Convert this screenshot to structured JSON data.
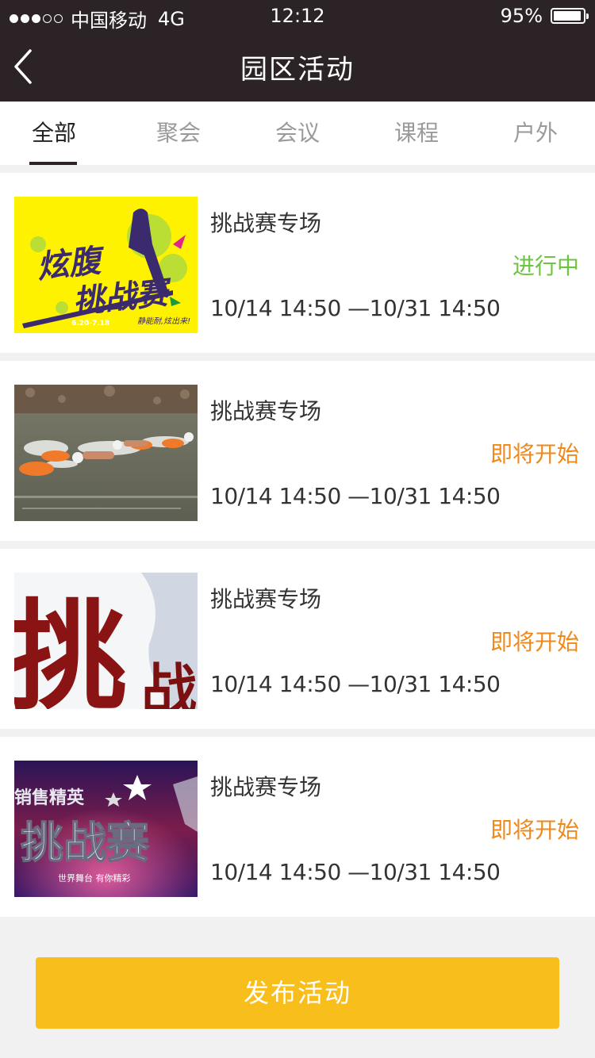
{
  "status_bar": {
    "carrier": "中国移动",
    "network": "4G",
    "time": "12:12",
    "battery": "95%",
    "signal_filled": 3,
    "signal_total": 5
  },
  "nav": {
    "title": "园区活动",
    "back_icon": "chevron-left-icon"
  },
  "tabs": [
    {
      "label": "全部",
      "active": true
    },
    {
      "label": "聚会",
      "active": false
    },
    {
      "label": "会议",
      "active": false
    },
    {
      "label": "课程",
      "active": false
    },
    {
      "label": "户外",
      "active": false
    }
  ],
  "activities": [
    {
      "title": "挑战赛专场",
      "status": "进行中",
      "status_color": "#6cc43f",
      "time_range": "10/14  14:50 —10/31  14:50",
      "thumb_text": "炫腹挑战赛",
      "thumb_sub": "6.20-7.18",
      "thumb_slogan": "静能耐,炫出来!"
    },
    {
      "title": "挑战赛专场",
      "status": "即将开始",
      "status_color": "#ee8a1c",
      "time_range": "10/14  14:50 —10/31  14:50"
    },
    {
      "title": "挑战赛专场",
      "status": "即将开始",
      "status_color": "#ee8a1c",
      "time_range": "10/14  14:50 —10/31  14:50",
      "thumb_text": "挑"
    },
    {
      "title": "挑战赛专场",
      "status": "即将开始",
      "status_color": "#ee8a1c",
      "time_range": "10/14  14:50 —10/31  14:50",
      "thumb_text": "挑战赛",
      "thumb_top": "销售精英",
      "thumb_bottom": "世界舞台 有你精彩"
    }
  ],
  "publish_button": {
    "label": "发布活动",
    "color": "#f8be1c"
  }
}
